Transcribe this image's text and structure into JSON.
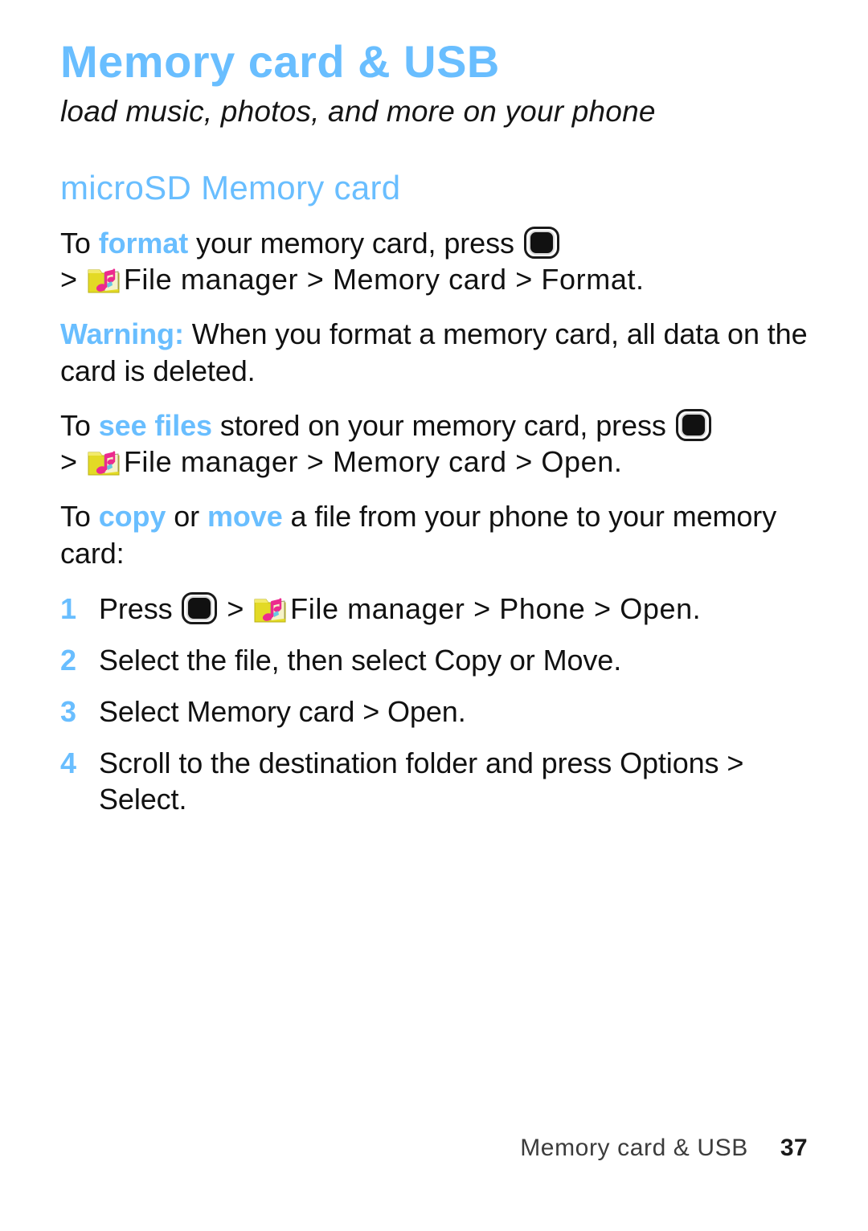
{
  "colors": {
    "accent_blue": "#69beff",
    "body_text": "#111111",
    "footer_text": "#3c3c3c",
    "page_background": "#ffffff",
    "icon_folder_yellow": "#e8df2e",
    "icon_note_pink": "#ec2a8e"
  },
  "header": {
    "chapter_title": "Memory card & USB",
    "chapter_subtitle": "load music, photos, and more on your phone"
  },
  "section": {
    "title": "microSD Memory card"
  },
  "paragraphs": {
    "format": {
      "line1_pre": "To ",
      "line1_highlight": "format",
      "line1_post": " your memory card, press ",
      "line2_gt1": ">",
      "line2_path": "File manager > Memory card > Format."
    },
    "warning": {
      "label": "Warning:",
      "text": " When you format a memory card, all data on the card is deleted."
    },
    "see_files": {
      "line1_pre": "To ",
      "line1_highlight": "see files",
      "line1_post": " stored on your memory card, press ",
      "line2_gt1": ">",
      "line2_path": "File manager > Memory card > Open."
    },
    "copy_move": {
      "pre": "To ",
      "highlight1": "copy",
      "mid": " or ",
      "highlight2": "move",
      "post": " a file from your phone to your memory card:"
    }
  },
  "steps": [
    {
      "number": "1",
      "pre": "Press ",
      "between": " > ",
      "post": "File manager > Phone > Open.",
      "has_center_key": true,
      "has_file_manager_icon": true
    },
    {
      "number": "2",
      "text": "Select the file, then select Copy or Move.",
      "has_center_key": false,
      "has_file_manager_icon": false
    },
    {
      "number": "3",
      "text": "Select Memory card > Open.",
      "has_center_key": false,
      "has_file_manager_icon": false
    },
    {
      "number": "4",
      "text": "Scroll to the destination folder and press Options > Select.",
      "has_center_key": false,
      "has_file_manager_icon": false
    }
  ],
  "icons": {
    "center_key": "center-select-key-icon",
    "file_manager": "file-manager-folder-music-icon"
  },
  "footer": {
    "title": "Memory card & USB",
    "page_number": "37"
  }
}
